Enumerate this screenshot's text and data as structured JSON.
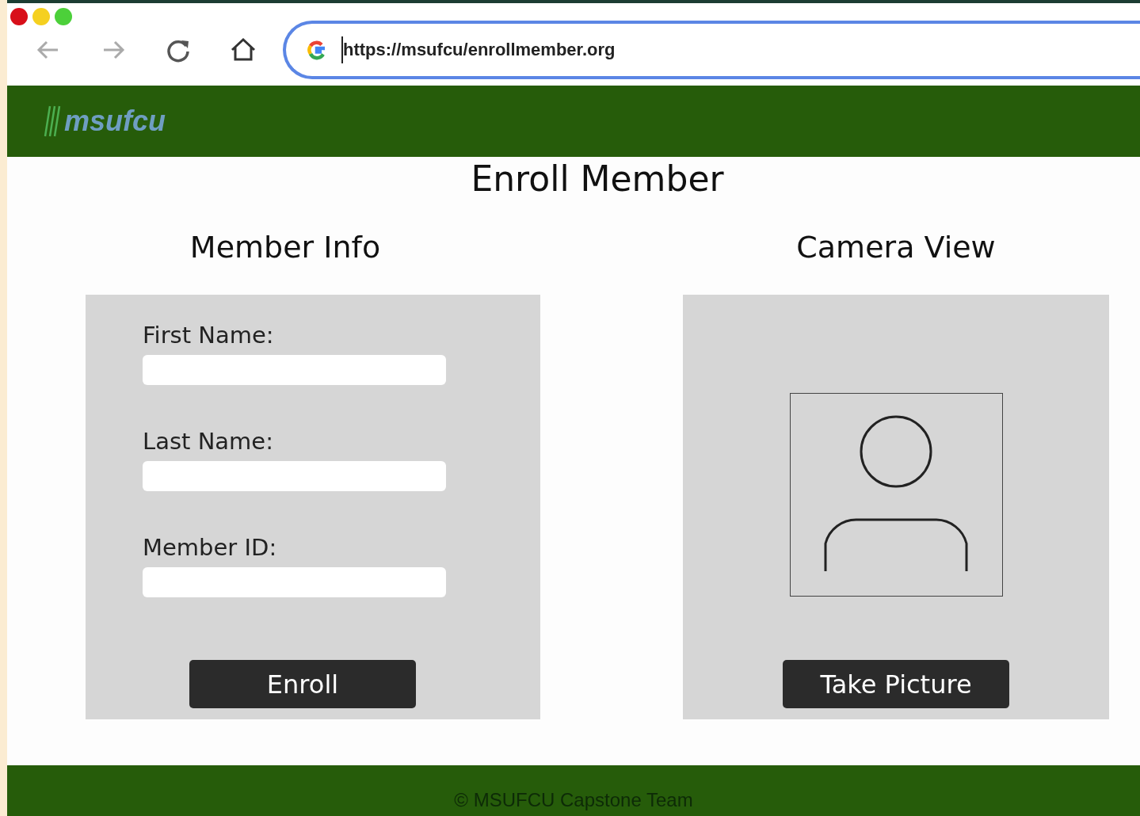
{
  "browser": {
    "url": "https://msufcu/enrollmember.org"
  },
  "header": {
    "logo": "msufcu"
  },
  "page": {
    "title": "Enroll Member"
  },
  "member_info": {
    "heading": "Member Info",
    "fields": [
      {
        "label": "First Name:"
      },
      {
        "label": "Last Name:"
      },
      {
        "label": "Member ID:"
      }
    ],
    "button": "Enroll"
  },
  "camera_view": {
    "heading": "Camera View",
    "button": "Take Picture"
  },
  "footer": {
    "text": "© MSUFCU Capstone Team"
  }
}
